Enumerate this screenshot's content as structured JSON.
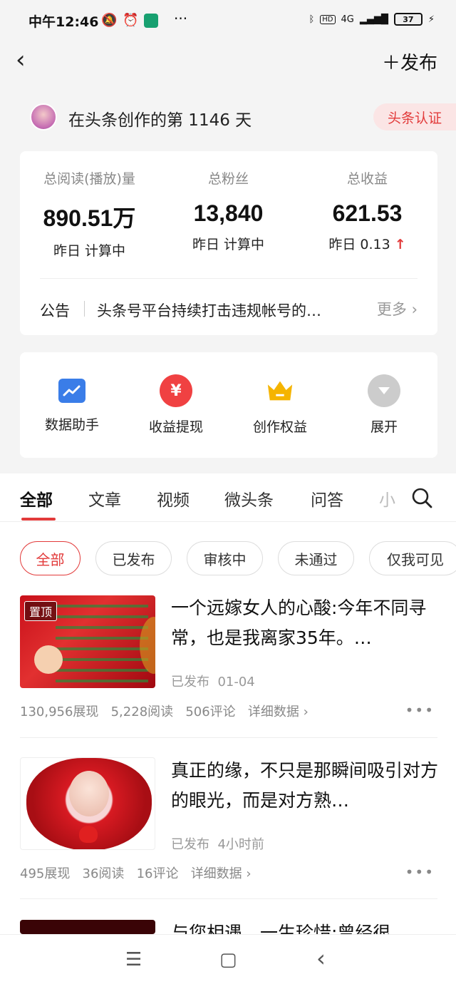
{
  "status_bar": {
    "time": "中午12:46",
    "network": "4G",
    "battery": "37"
  },
  "header": {
    "back_glyph": "‹",
    "publish_label": "＋发布"
  },
  "profile": {
    "days_text": "在头条创作的第 1146 天",
    "cert_label": "头条认证"
  },
  "stats": [
    {
      "label": "总阅读(播放)量",
      "value": "890.51万",
      "sub": "昨日 计算中"
    },
    {
      "label": "总粉丝",
      "value": "13,840",
      "sub": "昨日 计算中"
    },
    {
      "label": "总收益",
      "value": "621.53",
      "sub": "昨日 0.13",
      "trend": "↑"
    }
  ],
  "notice": {
    "label": "公告",
    "text": "头条号平台持续打击违规帐号的…",
    "more": "更多 ›"
  },
  "tools": [
    {
      "label": "数据助手",
      "icon": "chart-icon",
      "color": "#3a7de8"
    },
    {
      "label": "收益提现",
      "icon": "yuan-icon",
      "color": "#f04142"
    },
    {
      "label": "创作权益",
      "icon": "crown-icon",
      "color": "#f5b400"
    },
    {
      "label": "展开",
      "icon": "expand-icon",
      "color": "#cccccc"
    }
  ],
  "tabs": [
    "全部",
    "文章",
    "视频",
    "微头条",
    "问答",
    "小"
  ],
  "filters": [
    "全部",
    "已发布",
    "审核中",
    "未通过",
    "仅我可见"
  ],
  "posts": [
    {
      "pin": "置顶",
      "title": "一个远嫁女人的心酸:今年不同寻常，也是我离家35年。…",
      "status": "已发布",
      "time": "01-04",
      "impressions": "130,956展现",
      "reads": "5,228阅读",
      "comments": "506评论",
      "detail": "详细数据 ›"
    },
    {
      "title": "真正的缘，不只是那瞬间吸引对方的眼光，而是对方熟…",
      "status": "已发布",
      "time": "4小时前",
      "impressions": "495展现",
      "reads": "36阅读",
      "comments": "16评论",
      "detail": "详细数据 ›"
    },
    {
      "title": "与您相遇，一生珍惜;曾经很"
    }
  ],
  "more_glyph": "•••",
  "nav": {
    "menu": "☰",
    "home": "▢",
    "back": "‹"
  }
}
